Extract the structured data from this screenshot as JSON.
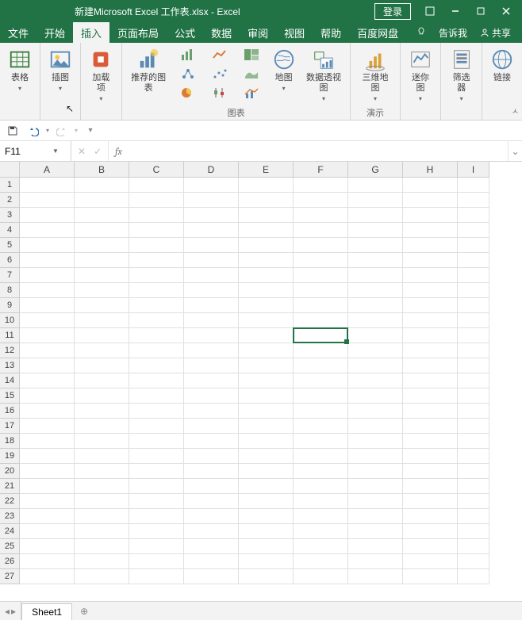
{
  "titlebar": {
    "title": "新建Microsoft Excel 工作表.xlsx - Excel",
    "login": "登录"
  },
  "menubar": {
    "tabs": [
      "文件",
      "开始",
      "插入",
      "页面布局",
      "公式",
      "数据",
      "审阅",
      "视图",
      "帮助",
      "百度网盘"
    ],
    "active_index": 2,
    "tell_me": "告诉我",
    "share": "共享"
  },
  "ribbon": {
    "tables": "表格",
    "illustrations": "插图",
    "addins": "加载项",
    "rec_charts": "推荐的图表",
    "charts_group": "图表",
    "maps": "地图",
    "pivotchart": "数据透视图",
    "map3d": "三维地图",
    "tours_group": "演示",
    "sparklines": "迷你图",
    "filters": "筛选器",
    "links": "链接"
  },
  "formula": {
    "namebox": "F11",
    "fx": "fx",
    "value": ""
  },
  "grid": {
    "cols": [
      "A",
      "B",
      "C",
      "D",
      "E",
      "F",
      "G",
      "H",
      "I"
    ],
    "rows": 27,
    "selected": {
      "row": 11,
      "col": "F"
    }
  },
  "sheetbar": {
    "sheet": "Sheet1"
  }
}
